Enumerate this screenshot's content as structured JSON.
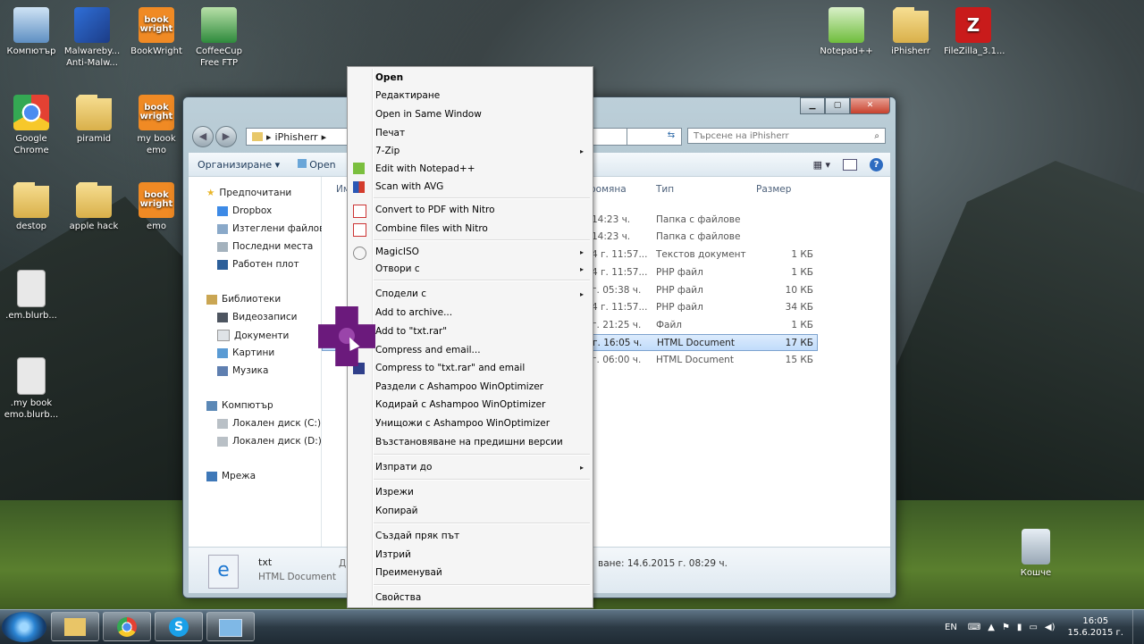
{
  "desktop_icons": [
    {
      "label": "Компютър",
      "x": 0,
      "y": 8
    },
    {
      "label": "Malwareby... Anti-Malw...",
      "x": 0,
      "y": 0
    },
    {
      "label": "BookWright"
    },
    {
      "label": "CoffeeCup Free FTP"
    },
    {
      "label": "Google Chrome"
    },
    {
      "label": "piramid"
    },
    {
      "label": "my book emo"
    },
    {
      "label": "destop"
    },
    {
      "label": "apple hack"
    },
    {
      "label": "emo"
    },
    {
      "label": ".em.blurb..."
    },
    {
      "label": ".my book emo.blurb..."
    },
    {
      "label": "Notepad++"
    },
    {
      "label": "iPhisherr"
    },
    {
      "label": "FileZilla_3.1..."
    },
    {
      "label": "Кошче"
    }
  ],
  "book_icon_text": "book\nwright",
  "window": {
    "address": "iPhisherr",
    "search_placeholder": "Търсене на iPhisherr",
    "toolbar": {
      "organize": "Организиране",
      "open": "Open"
    },
    "nav": {
      "favorites": "Предпочитани",
      "dropbox": "Dropbox",
      "downloads": "Изтеглени файлове",
      "recent": "Последни места",
      "desktop": "Работен плот",
      "libraries": "Библиотеки",
      "videos": "Видеозаписи",
      "documents": "Документи",
      "pictures": "Картини",
      "music": "Музика",
      "computer": "Компютър",
      "disk_c": "Локален диск (C:)",
      "disk_d": "Локален диск (D:)",
      "network": "Мрежа"
    },
    "columns": {
      "name": "Им",
      "modified": "ромяна",
      "type": "Тип",
      "size": "Размер"
    },
    "rows": [
      {
        "modified": "14:23 ч.",
        "type": "Папка с файлове",
        "size": ""
      },
      {
        "modified": "14:23 ч.",
        "type": "Папка с файлове",
        "size": ""
      },
      {
        "modified": "4 г. 11:57...",
        "type": "Текстов документ",
        "size": "1 КБ"
      },
      {
        "modified": "4 г. 11:57...",
        "type": "PHP файл",
        "size": "1 КБ"
      },
      {
        "modified": "г. 05:38 ч.",
        "type": "PHP файл",
        "size": "10 КБ"
      },
      {
        "modified": "4 г. 11:57...",
        "type": "PHP файл",
        "size": "34 КБ"
      },
      {
        "modified": "г. 21:25 ч.",
        "type": "Файл",
        "size": "1 КБ"
      },
      {
        "modified": "г. 16:05 ч.",
        "type": "HTML Document",
        "size": "17 КБ"
      },
      {
        "modified": "г. 06:00 ч.",
        "type": "HTML Document",
        "size": "15 КБ"
      }
    ],
    "details": {
      "name": "txt",
      "type": "HTML Document",
      "label_cut": "Да",
      "date": "ване: 14.6.2015 г. 08:29 ч."
    }
  },
  "context_menu": {
    "items": [
      {
        "label": "Open",
        "bold": true
      },
      {
        "label": "Редактиране"
      },
      {
        "label": "Open in Same Window"
      },
      {
        "label": "Печат"
      },
      {
        "label": "7-Zip",
        "submenu": true
      },
      {
        "label": "Edit with Notepad++"
      },
      {
        "label": "Scan with AVG"
      },
      {
        "label": "Convert to PDF with Nitro"
      },
      {
        "label": "Combine files with Nitro"
      },
      {
        "label": "MagicISO",
        "submenu": true
      },
      {
        "label": "Отвори с",
        "submenu": true
      },
      {
        "label": "Сподели с",
        "submenu": true
      },
      {
        "label": "Add to archive..."
      },
      {
        "label": "Add to \"txt.rar\""
      },
      {
        "label": "Compress and email..."
      },
      {
        "label": "Compress to \"txt.rar\" and email"
      },
      {
        "label": "Раздели с Ashampoo WinOptimizer"
      },
      {
        "label": "Кодирай с Ashampoo WinOptimizer"
      },
      {
        "label": "Унищожи с Ashampoo WinOptimizer"
      },
      {
        "label": "Възстановяване на предишни версии"
      },
      {
        "label": "Изпрати до",
        "submenu": true
      },
      {
        "label": "Изрежи"
      },
      {
        "label": "Копирай"
      },
      {
        "label": "Създай пряк път"
      },
      {
        "label": "Изтрий"
      },
      {
        "label": "Преименувай"
      },
      {
        "label": "Свойства"
      }
    ]
  },
  "taskbar": {
    "lang": "EN",
    "time": "16:05",
    "date": "15.6.2015 г."
  },
  "arrow_glyph": "▸",
  "colors": {
    "selection": "#c1dcfb",
    "menu_bg": "#f5f5f5",
    "cursor_highlight": "#6b1a7c"
  }
}
